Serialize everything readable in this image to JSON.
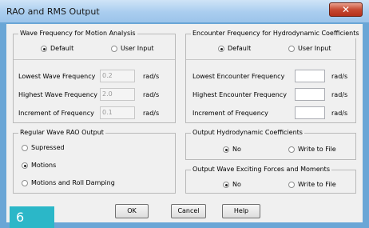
{
  "window": {
    "title": "RAO and RMS Output",
    "close_label": "✕"
  },
  "wave_freq": {
    "legend": "Wave Frequency for Motion Analysis",
    "options": [
      {
        "label": "Default",
        "selected": true
      },
      {
        "label": "User Input",
        "selected": false
      }
    ],
    "rows": [
      {
        "label": "Lowest Wave Frequency",
        "value": "0.2",
        "unit": "rad/s"
      },
      {
        "label": "Highest Wave Frequency",
        "value": "2.0",
        "unit": "rad/s"
      },
      {
        "label": "Increment of Frequency",
        "value": "0.1",
        "unit": "rad/s"
      }
    ]
  },
  "enc_freq": {
    "legend": "Encounter Frequency for Hydrodynamic Coefficients",
    "options": [
      {
        "label": "Default",
        "selected": true
      },
      {
        "label": "User Input",
        "selected": false
      }
    ],
    "rows": [
      {
        "label": "Lowest Encounter Frequency",
        "value": "",
        "unit": "rad/s"
      },
      {
        "label": "Highest Encounter Frequency",
        "value": "",
        "unit": "rad/s"
      },
      {
        "label": "Increment of Frequency",
        "value": "",
        "unit": "rad/s"
      }
    ]
  },
  "rao_output": {
    "legend": "Regular Wave RAO Output",
    "options": [
      {
        "label": "Supressed",
        "selected": false
      },
      {
        "label": "Motions",
        "selected": true
      },
      {
        "label": "Motions and Roll Damping",
        "selected": false
      }
    ]
  },
  "hydro_output": {
    "legend": "Output Hydrodynamic Coefficients",
    "options": [
      {
        "label": "No",
        "selected": true
      },
      {
        "label": "Write to File",
        "selected": false
      }
    ]
  },
  "force_output": {
    "legend": "Output Wave Exciting Forces and Moments",
    "options": [
      {
        "label": "No",
        "selected": true
      },
      {
        "label": "Write to File",
        "selected": false
      }
    ]
  },
  "buttons": {
    "ok": "OK",
    "cancel": "Cancel",
    "help": "Help"
  },
  "badge": "6",
  "colors": {
    "titlebar": "#a9cdef",
    "close_button": "#c74a32",
    "badge": "#2bb7c8",
    "dialog_bg": "#f0f0f0"
  }
}
